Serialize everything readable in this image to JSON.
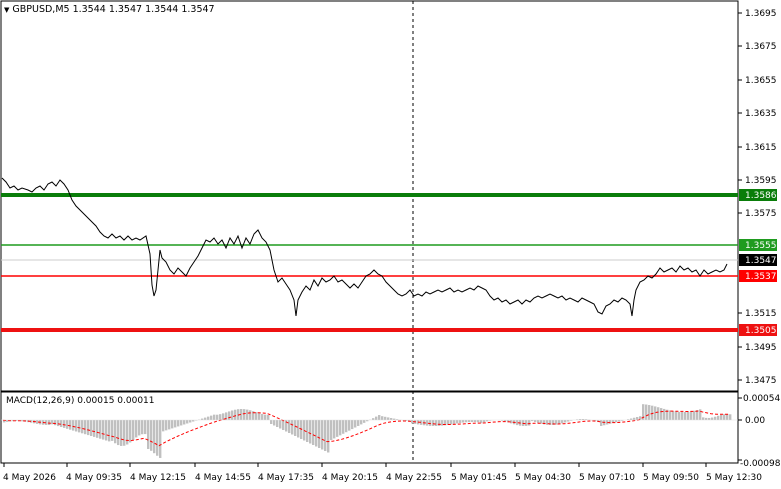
{
  "header": {
    "symbol": "GBPUSD,M5",
    "ohlc": "1.3544 1.3547 1.3544 1.3547"
  },
  "indicator": {
    "label": "MACD(12,26,9) 0.00015 0.00011"
  },
  "price_axis": {
    "ticks": [
      "1.3695",
      "1.3675",
      "1.3655",
      "1.3635",
      "1.3615",
      "1.3595",
      "1.3575",
      "1.3515",
      "1.3495",
      "1.3475"
    ]
  },
  "macd_axis": {
    "ticks": [
      "0.00054",
      "0.00",
      "-0.00098"
    ]
  },
  "time_axis": {
    "labels": [
      "4 May 2026",
      "4 May 09:35",
      "4 May 12:15",
      "4 May 14:55",
      "4 May 17:35",
      "4 May 20:15",
      "4 May 22:55",
      "5 May 01:45",
      "5 May 04:30",
      "5 May 07:10",
      "5 May 09:50",
      "5 May 12:30"
    ]
  },
  "levels": [
    {
      "price": "1.3586",
      "color": "#0a7d0a",
      "weight": "thick"
    },
    {
      "price": "1.3555",
      "color": "#1f9b1f",
      "weight": "thin"
    },
    {
      "price": "1.3537",
      "color": "#ff0000",
      "weight": "thin"
    },
    {
      "price": "1.3505",
      "color": "#ee1111",
      "weight": "thick"
    }
  ],
  "current_price": {
    "price": "1.3547",
    "color": "#000000"
  },
  "colors": {
    "price_line": "#000000",
    "histogram": "#c0c0c0",
    "signal": "#ff0000",
    "crosshair": "#000000",
    "grid": "#d8d8d8"
  },
  "icons": {
    "dropdown": "triangle-down-icon"
  }
}
